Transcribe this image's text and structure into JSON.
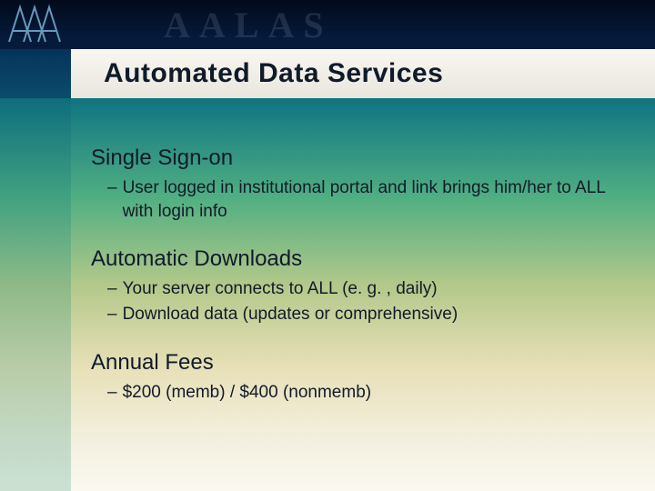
{
  "header": {
    "ghost": "AALAS"
  },
  "title": "Automated Data Services",
  "sections": [
    {
      "heading": "Single Sign-on",
      "bullets": [
        "User logged in institutional portal and link brings him/her to ALL with login info"
      ]
    },
    {
      "heading": "Automatic Downloads",
      "bullets": [
        "Your server connects to ALL (e. g. , daily)",
        "Download data (updates or comprehensive)"
      ]
    },
    {
      "heading": "Annual Fees",
      "bullets": [
        "$200 (memb) / $400 (nonmemb)"
      ]
    }
  ]
}
